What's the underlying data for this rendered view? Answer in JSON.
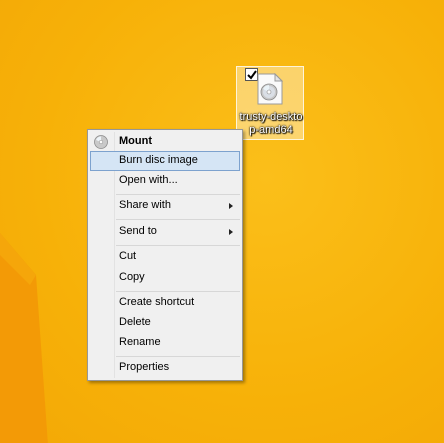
{
  "desktop": {
    "background_color": "#F9B40A",
    "icon": {
      "label": "trusty-desktop-amd64",
      "label_line1": "trusty-deskto",
      "label_line2": "p-amd64",
      "selected": true,
      "icon_name": "disc-image-file-icon"
    }
  },
  "context_menu": {
    "items": [
      {
        "label": "Mount",
        "bold": true,
        "icon": "disc-icon"
      },
      {
        "label": "Burn disc image",
        "highlighted": true
      },
      {
        "label": "Open with..."
      },
      {
        "label": "Share with",
        "submenu": true
      },
      {
        "label": "Send to",
        "submenu": true
      },
      {
        "label": "Cut"
      },
      {
        "label": "Copy"
      },
      {
        "label": "Create shortcut"
      },
      {
        "label": "Delete"
      },
      {
        "label": "Rename"
      },
      {
        "label": "Properties"
      }
    ],
    "highlight_color": "#D5E5F5",
    "highlight_border": "#7DA2CE"
  }
}
